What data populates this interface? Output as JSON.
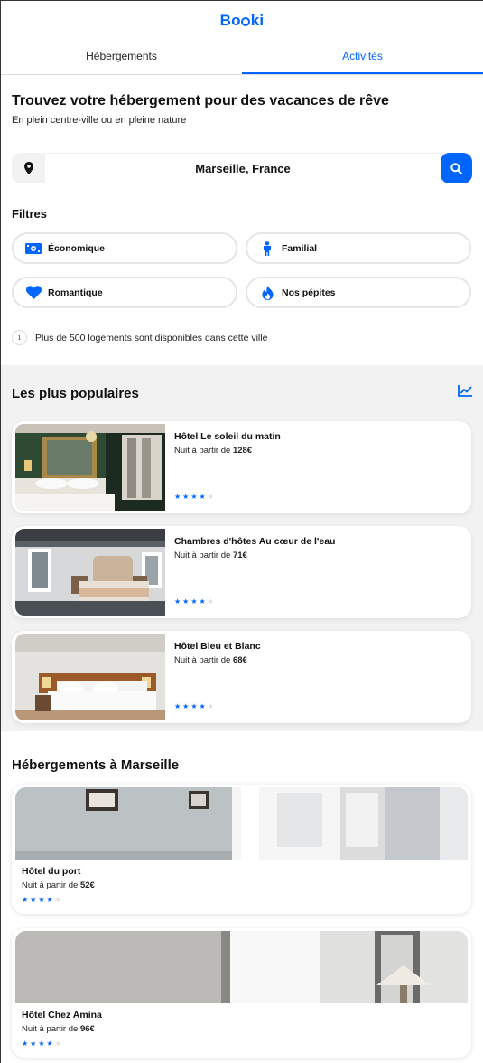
{
  "header": {
    "logo_text": "Booki"
  },
  "tabs": [
    {
      "label": "Hébergements",
      "active": false
    },
    {
      "label": "Activités",
      "active": true
    }
  ],
  "search": {
    "title": "Trouvez votre hébergement pour des vacances de rêve",
    "subtitle": "En plein centre-ville ou en pleine nature",
    "value": "Marseille, France",
    "pin_icon": "map-marker-icon",
    "button_icon": "search-icon"
  },
  "filters": {
    "title": "Filtres",
    "items": [
      {
        "label": "Économique",
        "icon": "money-icon"
      },
      {
        "label": "Familial",
        "icon": "child-icon"
      },
      {
        "label": "Romantique",
        "icon": "heart-icon"
      },
      {
        "label": "Nos pépites",
        "icon": "fire-icon"
      }
    ]
  },
  "info": {
    "icon": "info-icon",
    "text": "Plus de 500 logements sont disponibles dans cette ville"
  },
  "popular": {
    "title": "Les plus populaires",
    "icon": "chart-line-icon",
    "price_prefix": "Nuit à partir de",
    "items": [
      {
        "name": "Hôtel Le soleil du matin",
        "price": "128€",
        "rating": 4
      },
      {
        "name": "Chambres d'hôtes Au cœur de l'eau",
        "price": "71€",
        "rating": 4
      },
      {
        "name": "Hôtel Bleu et Blanc",
        "price": "68€",
        "rating": 4
      }
    ]
  },
  "lodging": {
    "title": "Hébergements à Marseille",
    "price_prefix": "Nuit à partir de",
    "items": [
      {
        "name": "Hôtel du port",
        "price": "52€",
        "rating": 4
      },
      {
        "name": "Hôtel Chez Amina",
        "price": "96€",
        "rating": 4
      }
    ]
  },
  "colors": {
    "accent": "#0065FC",
    "section_bg": "#F2F2F2",
    "star_off": "#DDDDDD"
  }
}
